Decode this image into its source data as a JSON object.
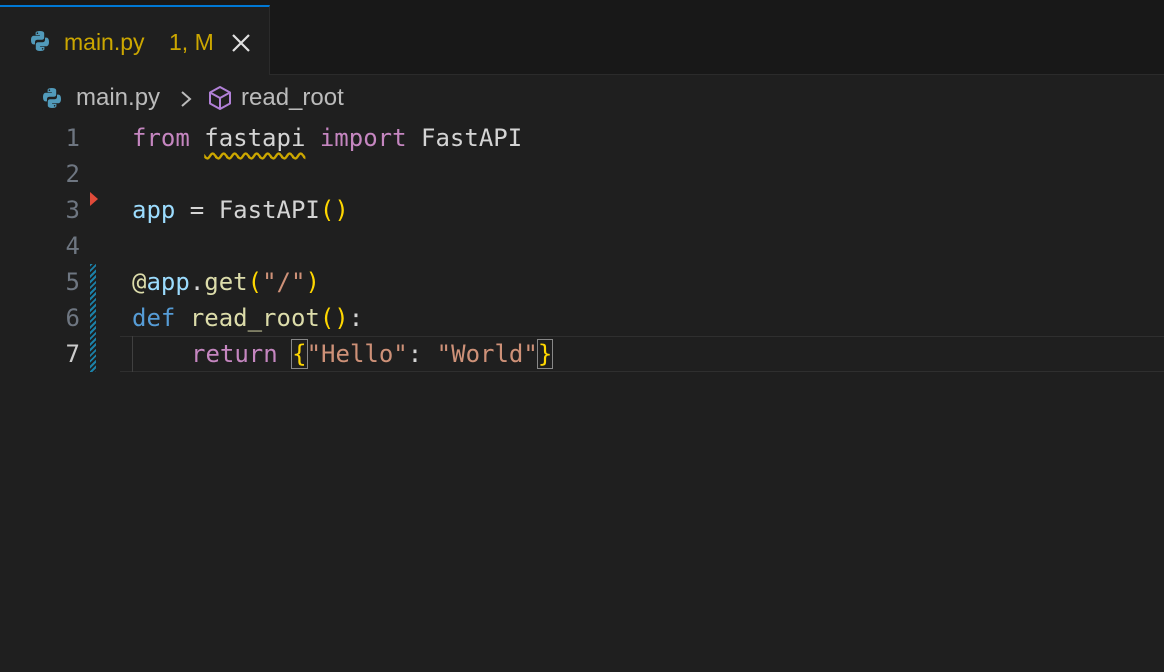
{
  "tab": {
    "filename": "main.py",
    "badge": "1, M"
  },
  "breadcrumb": {
    "file": "main.py",
    "symbol": "read_root"
  },
  "editor": {
    "active_line": 7,
    "lines": [
      {
        "num": "1"
      },
      {
        "num": "2"
      },
      {
        "num": "3"
      },
      {
        "num": "4"
      },
      {
        "num": "5"
      },
      {
        "num": "6"
      },
      {
        "num": "7"
      }
    ],
    "tokens": {
      "l1_from": "from",
      "l1_module": "fastapi",
      "l1_import": "import",
      "l1_class": "FastAPI",
      "l3_var": "app",
      "l3_eq": " = ",
      "l3_call": "FastAPI",
      "l3_paren": "()",
      "l5_at": "@",
      "l5_app": "app",
      "l5_dot": ".",
      "l5_get": "get",
      "l5_open": "(",
      "l5_str": "\"/\"",
      "l5_close": ")",
      "l6_def": "def",
      "l6_name": "read_root",
      "l6_paren": "()",
      "l6_colon": ":",
      "l7_return": "return",
      "l7_open": "{",
      "l7_key": "\"Hello\"",
      "l7_colon": ": ",
      "l7_val": "\"World\"",
      "l7_close": "}"
    }
  },
  "colors": {
    "tab_modified": "#cca700",
    "accent": "#0078d4"
  }
}
